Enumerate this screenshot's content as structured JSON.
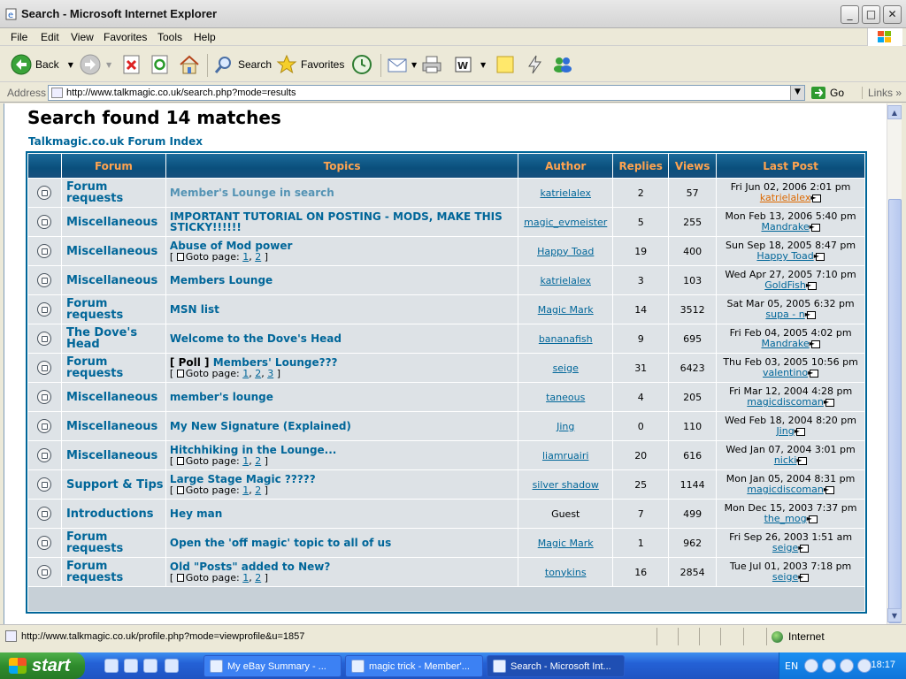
{
  "window": {
    "title": "Search - Microsoft Internet Explorer"
  },
  "menu": [
    "File",
    "Edit",
    "View",
    "Favorites",
    "Tools",
    "Help"
  ],
  "toolbar": {
    "back": "Back",
    "search": "Search",
    "favorites": "Favorites"
  },
  "address": {
    "label": "Address",
    "url": "http://www.talkmagic.co.uk/search.php?mode=results",
    "go": "Go",
    "links": "Links"
  },
  "page": {
    "heading": "Search found 14 matches",
    "forum_index": "Talkmagic.co.uk Forum Index",
    "columns": [
      "Forum",
      "Topics",
      "Author",
      "Replies",
      "Views",
      "Last Post"
    ],
    "goto_label": "Goto page:",
    "poll_label": "[ Poll ]",
    "rows": [
      {
        "forum": "Forum requests",
        "topic": "Member's Lounge in search",
        "author": "katrielalex",
        "replies": "2",
        "views": "57",
        "last_date": "Fri Jun 02, 2006 2:01 pm",
        "last_user": "katrielalex"
      },
      {
        "forum": "Miscellaneous",
        "topic": "IMPORTANT TUTORIAL ON POSTING - MODS, MAKE THIS STICKY!!!!!!",
        "author": "magic_evmeister",
        "replies": "5",
        "views": "255",
        "last_date": "Mon Feb 13, 2006 5:40 pm",
        "last_user": "Mandrake"
      },
      {
        "forum": "Miscellaneous",
        "topic": "Abuse of Mod power",
        "pages": [
          "1",
          "2"
        ],
        "author": "Happy Toad",
        "replies": "19",
        "views": "400",
        "last_date": "Sun Sep 18, 2005 8:47 pm",
        "last_user": "Happy Toad"
      },
      {
        "forum": "Miscellaneous",
        "topic": "Members Lounge",
        "author": "katrielalex",
        "replies": "3",
        "views": "103",
        "last_date": "Wed Apr 27, 2005 7:10 pm",
        "last_user": "GoldFish"
      },
      {
        "forum": "Forum requests",
        "topic": "MSN list",
        "author": "Magic Mark",
        "replies": "14",
        "views": "3512",
        "last_date": "Sat Mar 05, 2005 6:32 pm",
        "last_user": "supa - n"
      },
      {
        "forum": "The Dove's Head",
        "topic": "Welcome to the Dove's Head",
        "author": "bananafish",
        "replies": "9",
        "views": "695",
        "last_date": "Fri Feb 04, 2005 4:02 pm",
        "last_user": "Mandrake"
      },
      {
        "forum": "Forum requests",
        "topic": "Members' Lounge???",
        "poll": true,
        "pages": [
          "1",
          "2",
          "3"
        ],
        "author": "seige",
        "replies": "31",
        "views": "6423",
        "last_date": "Thu Feb 03, 2005 10:56 pm",
        "last_user": "valentino"
      },
      {
        "forum": "Miscellaneous",
        "topic": "member's lounge",
        "author": "taneous",
        "replies": "4",
        "views": "205",
        "last_date": "Fri Mar 12, 2004 4:28 pm",
        "last_user": "magicdiscoman"
      },
      {
        "forum": "Miscellaneous",
        "topic": "My New Signature (Explained)",
        "author": "Jing",
        "replies": "0",
        "views": "110",
        "last_date": "Wed Feb 18, 2004 8:20 pm",
        "last_user": "Jing"
      },
      {
        "forum": "Miscellaneous",
        "topic": "Hitchhiking in the Lounge...",
        "pages": [
          "1",
          "2"
        ],
        "author": "liamruairi",
        "replies": "20",
        "views": "616",
        "last_date": "Wed Jan 07, 2004 3:01 pm",
        "last_user": "nicki"
      },
      {
        "forum": "Support & Tips",
        "topic": "Large Stage Magic ?????",
        "pages": [
          "1",
          "2"
        ],
        "author": "silver shadow",
        "replies": "25",
        "views": "1144",
        "last_date": "Mon Jan 05, 2004 8:31 pm",
        "last_user": "magicdiscoman"
      },
      {
        "forum": "Introductions",
        "topic": "Hey man",
        "author": "Guest",
        "guest": true,
        "replies": "7",
        "views": "499",
        "last_date": "Mon Dec 15, 2003 7:37 pm",
        "last_user": "the_mog"
      },
      {
        "forum": "Forum requests",
        "topic": "Open the 'off magic' topic to all of us",
        "author": "Magic Mark",
        "replies": "1",
        "views": "962",
        "last_date": "Fri Sep 26, 2003 1:51 am",
        "last_user": "seige"
      },
      {
        "forum": "Forum requests",
        "topic": "Old \"Posts\" added to New?",
        "pages": [
          "1",
          "2"
        ],
        "author": "tonykins",
        "replies": "16",
        "views": "2854",
        "last_date": "Tue Jul 01, 2003 7:18 pm",
        "last_user": "seige"
      }
    ]
  },
  "status": {
    "text": "http://www.talkmagic.co.uk/profile.php?mode=viewprofile&u=1857",
    "zone": "Internet"
  },
  "taskbar": {
    "start": "start",
    "tasks": [
      "My eBay Summary - ...",
      "magic trick - Member'...",
      "Search - Microsoft Int..."
    ],
    "lang": "EN",
    "clock": "18:17"
  },
  "colors": {
    "link": "#006699",
    "header_text": "#ffa34f",
    "row_bg": "#dee3e7"
  }
}
